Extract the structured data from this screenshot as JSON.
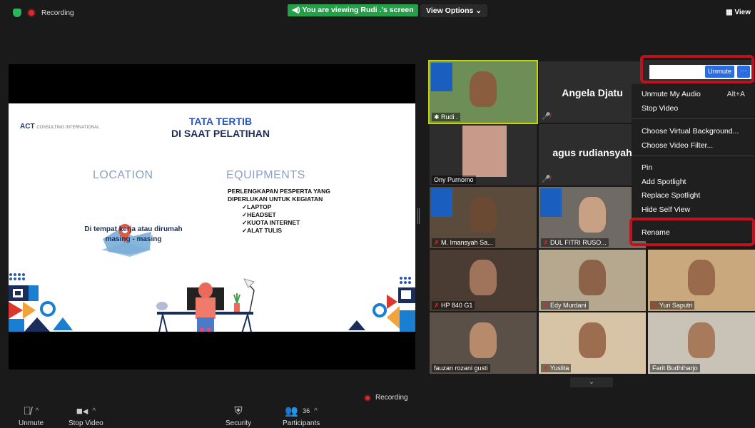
{
  "top": {
    "recording_label": "Recording",
    "viewing_banner": "You are viewing Rudi .'s screen",
    "view_options": "View Options ⌄",
    "view_button": "View"
  },
  "slide": {
    "logo_text": "ACT",
    "logo_sub": "CONSULTING INTERNATIONAL",
    "title_line1": "TATA TERTIB",
    "title_line2": "DI SAAT PELATIHAN",
    "location_heading": "LOCATION",
    "equipments_heading": "EQUIPMENTS",
    "location_text_1": "Di tempat kerja atau dirumah",
    "location_text_2": "masing - masing",
    "equip_intro_1": "PERLENGKAPAN PESPERTA YANG",
    "equip_intro_2": "DIPERLUKAN UNTUK KEGIATAN",
    "equip_items": [
      "✓LAPTOP",
      "✓HEADSET",
      "✓KUOTA INTERNET",
      "✓ALAT TULIS"
    ]
  },
  "participants": [
    {
      "name": "Rudi .",
      "big": ""
    },
    {
      "name": "",
      "big": "Angela Djatu"
    },
    {
      "name": "Ony Purnomo",
      "big": ""
    },
    {
      "name": "",
      "big": "agus rudiansyah"
    },
    {
      "name": "M. Imansyah Sa...",
      "big": ""
    },
    {
      "name": "DUL FITRI RUSO...",
      "big": ""
    },
    {
      "name": "HP 840 G1",
      "big": ""
    },
    {
      "name": "Edy Murdani",
      "big": ""
    },
    {
      "name": "Yuri Saputri",
      "big": ""
    },
    {
      "name": "fauzan rozani gusti",
      "big": ""
    },
    {
      "name": "Yuslita",
      "big": ""
    },
    {
      "name": "Farit Budhiharjo",
      "big": ""
    }
  ],
  "self_view": {
    "unmute_label": "Unmute",
    "more_label": "···"
  },
  "menu": {
    "unmute_audio": "Unmute My Audio",
    "unmute_shortcut": "Alt+A",
    "stop_video": "Stop Video",
    "virtual_bg": "Choose Virtual Background...",
    "video_filter": "Choose Video Filter...",
    "pin": "Pin",
    "add_spotlight": "Add Spotlight",
    "replace_spotlight": "Replace Spotlight",
    "hide_self": "Hide Self View",
    "rename": "Rename"
  },
  "bottom": {
    "unmute": "Unmute",
    "stop_video": "Stop Video",
    "security": "Security",
    "participants": "Participants",
    "participants_count": "36",
    "recording": "Recording"
  }
}
